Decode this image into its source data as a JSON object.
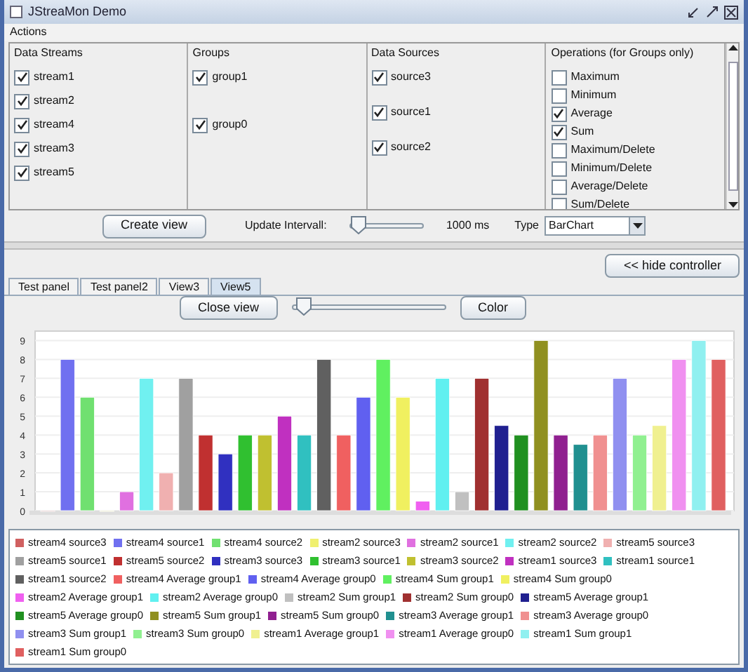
{
  "window": {
    "title": "JStreaMon Demo"
  },
  "menu": [
    "Actions"
  ],
  "panels": [
    {
      "title": "Data Streams",
      "items": [
        {
          "label": "stream1",
          "checked": true
        },
        {
          "label": "stream2",
          "checked": true
        },
        {
          "label": "stream4",
          "checked": true
        },
        {
          "label": "stream3",
          "checked": true
        },
        {
          "label": "stream5",
          "checked": true
        }
      ]
    },
    {
      "title": "Groups",
      "items": [
        {
          "label": "group1",
          "checked": true
        },
        {
          "label": "group0",
          "checked": true
        }
      ]
    },
    {
      "title": "Data Sources",
      "items": [
        {
          "label": "source3",
          "checked": true
        },
        {
          "label": "source1",
          "checked": true
        },
        {
          "label": "source2",
          "checked": true
        }
      ]
    },
    {
      "title": "Operations (for Groups only)",
      "items": [
        {
          "label": "Maximum",
          "checked": false
        },
        {
          "label": "Minimum",
          "checked": false
        },
        {
          "label": "Average",
          "checked": true
        },
        {
          "label": "Sum",
          "checked": true
        },
        {
          "label": "Maximum/Delete",
          "checked": false
        },
        {
          "label": "Minimum/Delete",
          "checked": false
        },
        {
          "label": "Average/Delete",
          "checked": false
        },
        {
          "label": "Sum/Delete",
          "checked": false
        }
      ]
    }
  ],
  "controls": {
    "create_button": "Create view",
    "interval_label": "Update Intervall:",
    "interval": {
      "level": 0.06
    },
    "interval_reading": "1000 ms",
    "type_label": "Type",
    "type_value": "BarChart"
  },
  "hide_button": "<< hide controller",
  "tabs": [
    {
      "label": "Test panel",
      "selected": false
    },
    {
      "label": "Test panel2",
      "selected": false
    },
    {
      "label": "View3",
      "selected": false
    },
    {
      "label": "View5",
      "selected": true
    }
  ],
  "view_toolbar": {
    "close_button": "Close view",
    "slider": {
      "level": 0.08
    },
    "color_button": "Color"
  },
  "chart_data": {
    "type": "bar",
    "grid": true,
    "ylim": [
      0,
      9.5
    ],
    "yticks": [
      0,
      1,
      2,
      3,
      4,
      5,
      6,
      7,
      8,
      9
    ],
    "series": [
      {
        "name": "stream4 source3",
        "color": "#d06060",
        "values": [
          0
        ]
      },
      {
        "name": "stream4 source1",
        "color": "#7070f0",
        "values": [
          8
        ]
      },
      {
        "name": "stream4 source2",
        "color": "#70e070",
        "values": [
          6
        ]
      },
      {
        "name": "stream2 source3",
        "color": "#f0f070",
        "values": [
          0
        ]
      },
      {
        "name": "stream2 source1",
        "color": "#e070e0",
        "values": [
          1
        ]
      },
      {
        "name": "stream2 source2",
        "color": "#70f0f0",
        "values": [
          7
        ]
      },
      {
        "name": "stream5 source3",
        "color": "#f0b0b0",
        "values": [
          2
        ]
      },
      {
        "name": "stream5 source1",
        "color": "#a0a0a0",
        "values": [
          7
        ]
      },
      {
        "name": "stream5 source2",
        "color": "#c03030",
        "values": [
          4
        ]
      },
      {
        "name": "stream3 source3",
        "color": "#3030c0",
        "values": [
          3
        ]
      },
      {
        "name": "stream3 source1",
        "color": "#30c030",
        "values": [
          4
        ]
      },
      {
        "name": "stream3 source2",
        "color": "#c0c030",
        "values": [
          4
        ]
      },
      {
        "name": "stream1 source3",
        "color": "#c030c0",
        "values": [
          5
        ]
      },
      {
        "name": "stream1 source1",
        "color": "#30c0c0",
        "values": [
          4
        ]
      },
      {
        "name": "stream1 source2",
        "color": "#606060",
        "values": [
          8
        ]
      },
      {
        "name": "stream4 Average group1",
        "color": "#f06060",
        "values": [
          4
        ]
      },
      {
        "name": "stream4 Average group0",
        "color": "#6060f0",
        "values": [
          6
        ]
      },
      {
        "name": "stream4 Sum group1",
        "color": "#60f060",
        "values": [
          8
        ]
      },
      {
        "name": "stream4 Sum group0",
        "color": "#f0f060",
        "values": [
          6
        ]
      },
      {
        "name": "stream2 Average group1",
        "color": "#f060f0",
        "values": [
          0.5
        ]
      },
      {
        "name": "stream2 Average group0",
        "color": "#60f0f0",
        "values": [
          7
        ]
      },
      {
        "name": "stream2 Sum group1",
        "color": "#c0c0c0",
        "values": [
          1
        ]
      },
      {
        "name": "stream2 Sum group0",
        "color": "#a03030",
        "values": [
          7
        ]
      },
      {
        "name": "stream5 Average group1",
        "color": "#202090",
        "values": [
          4.5
        ]
      },
      {
        "name": "stream5 Average group0",
        "color": "#209020",
        "values": [
          4
        ]
      },
      {
        "name": "stream5 Sum group1",
        "color": "#909020",
        "values": [
          9
        ]
      },
      {
        "name": "stream5 Sum group0",
        "color": "#902090",
        "values": [
          4
        ]
      },
      {
        "name": "stream3 Average group1",
        "color": "#209090",
        "values": [
          3.5
        ]
      },
      {
        "name": "stream3 Average group0",
        "color": "#f09090",
        "values": [
          4
        ]
      },
      {
        "name": "stream3 Sum group1",
        "color": "#9090f0",
        "values": [
          7
        ]
      },
      {
        "name": "stream3 Sum group0",
        "color": "#90f090",
        "values": [
          4
        ]
      },
      {
        "name": "stream1 Average group1",
        "color": "#f0f090",
        "values": [
          4.5
        ]
      },
      {
        "name": "stream1 Average group0",
        "color": "#f090f0",
        "values": [
          8
        ]
      },
      {
        "name": "stream1 Sum group1",
        "color": "#90f0f0",
        "values": [
          9
        ]
      },
      {
        "name": "stream1 Sum group0",
        "color": "#e06060",
        "values": [
          8
        ]
      }
    ]
  }
}
